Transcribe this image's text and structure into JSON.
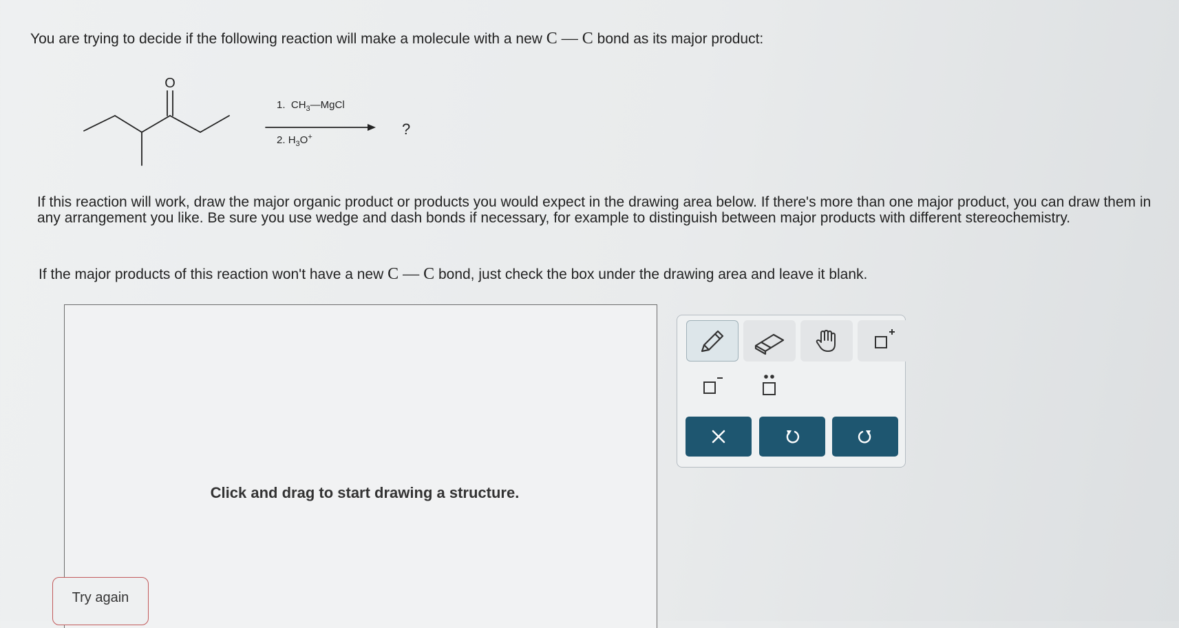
{
  "question": {
    "intro_before": "You are trying to decide if the following reaction will make a molecule with a new ",
    "cc_bond": "C — C",
    "intro_after": " bond as its major product:",
    "instructions": "If this reaction will work, draw the major organic product or products you would expect in the drawing area below. If there's more than one major product, you can draw them in any arrangement you like. Be sure you use wedge and dash bonds if necessary, for example to distinguish between major products with different stereochemistry.",
    "blank_before": "If the major products of this reaction won't have a new ",
    "blank_after": " bond, just check the box under the drawing area and leave it blank."
  },
  "reaction": {
    "oxygen_label": "O",
    "step1_num": "1.",
    "step1_reagent": "CH",
    "step1_sub": "3",
    "step1_rest": "—MgCl",
    "step2_num": "2.",
    "step2_reagent": "H",
    "step2_sub": "3",
    "step2_rest": "O",
    "step2_sup": "+",
    "product": "?"
  },
  "drawing": {
    "hint": "Click and drag to start drawing a structure."
  },
  "toolbar": {
    "tools": [
      "pencil-icon",
      "eraser-icon",
      "hand-icon",
      "positive-charge-icon",
      "negative-charge-icon",
      "lone-pair-icon"
    ],
    "actions": [
      "clear-icon",
      "undo-icon",
      "redo-icon"
    ],
    "accent": "#1e5670"
  },
  "buttons": {
    "try_again": "Try again"
  }
}
